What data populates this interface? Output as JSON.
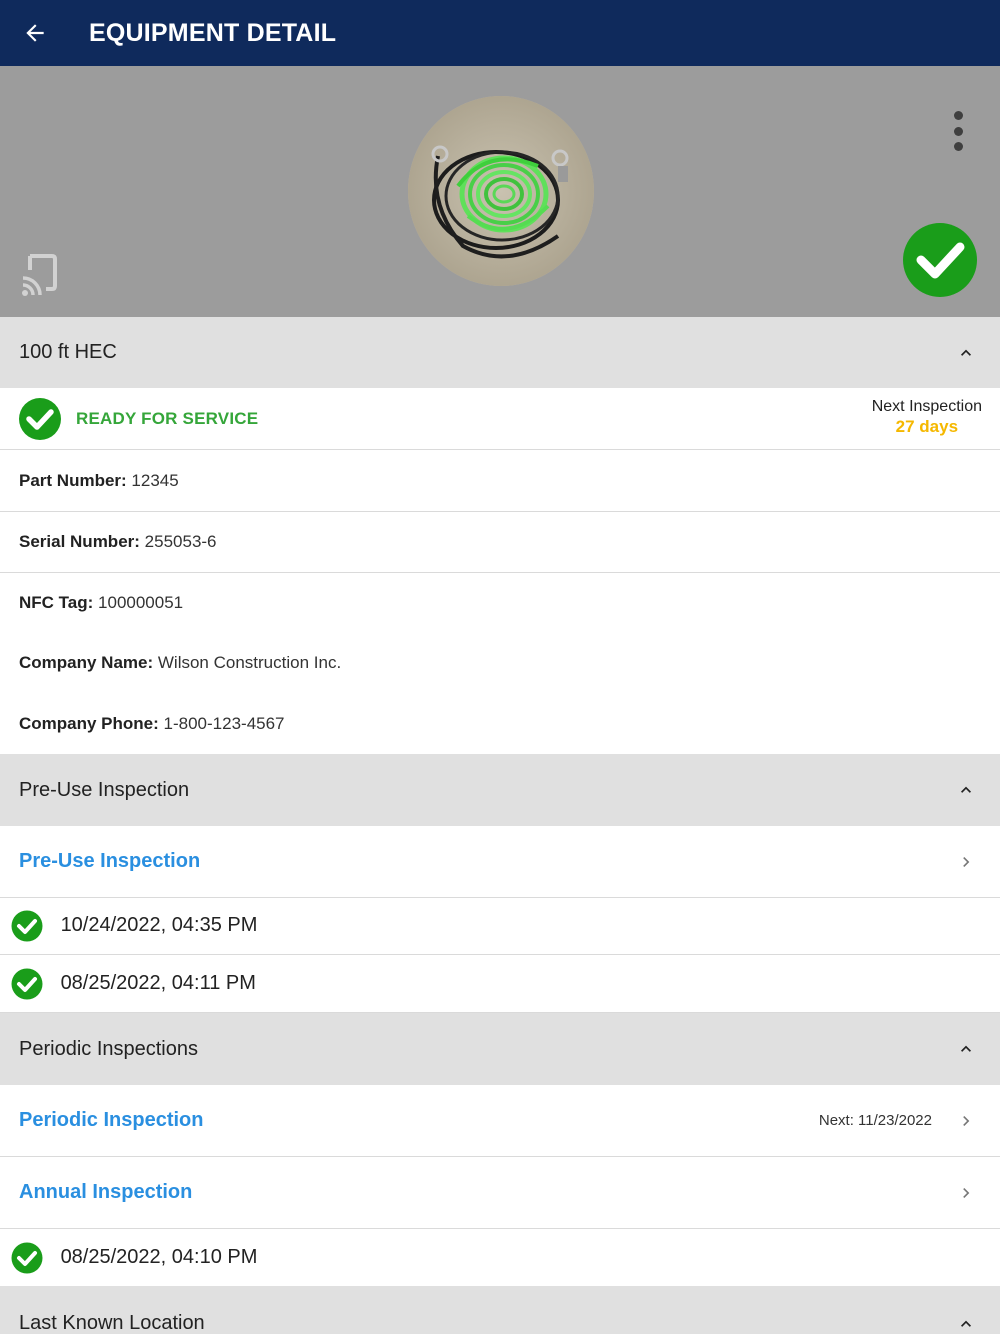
{
  "appbar": {
    "title": "EQUIPMENT DETAIL"
  },
  "equipment": {
    "name": "100 ft HEC",
    "status": "READY FOR SERVICE",
    "next_inspection_label": "Next Inspection",
    "next_inspection_value": "27 days",
    "details": [
      {
        "label": "Part Number:",
        "value": "12345"
      },
      {
        "label": "Serial Number:",
        "value": "255053-6"
      },
      {
        "label": "NFC Tag:",
        "value": "100000051"
      },
      {
        "label": "Company Name:",
        "value": "Wilson Construction Inc."
      },
      {
        "label": "Company Phone:",
        "value": "1-800-123-4567"
      }
    ]
  },
  "pre_use": {
    "section_title": "Pre-Use Inspection",
    "link_label": "Pre-Use Inspection",
    "history": [
      "10/24/2022, 04:35 PM",
      "08/25/2022, 04:11 PM"
    ]
  },
  "periodic": {
    "section_title": "Periodic Inspections",
    "periodic_label": "Periodic Inspection",
    "periodic_next": "Next: 11/23/2022",
    "annual_label": "Annual Inspection",
    "history": [
      "08/25/2022, 04:10 PM"
    ]
  },
  "location": {
    "section_title": "Last Known Location"
  },
  "colors": {
    "appbar": "#0f2a5c",
    "status_green": "#35a63a",
    "check_green": "#1a9d1a",
    "warning_yellow": "#f5b800",
    "link_blue": "#2a8fe0"
  },
  "icons": {
    "back": "arrow-left-icon",
    "menu": "more-vertical-icon",
    "nfc": "nfc-phone-icon",
    "status": "check-circle-icon",
    "collapse": "chevron-up-icon",
    "open": "chevron-right-icon"
  }
}
